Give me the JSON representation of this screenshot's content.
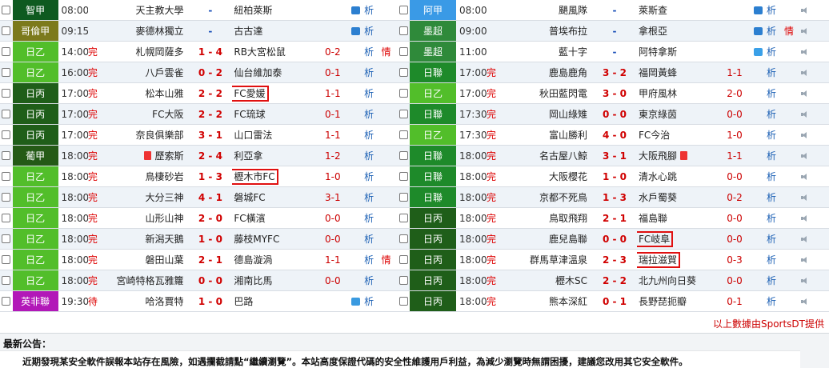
{
  "left_matches": [
    {
      "league": "智甲",
      "league_color": "#0e5a20",
      "time": "08:00",
      "status": "",
      "home": "天主教大學",
      "score": "-",
      "away": "紐柏萊斯",
      "handicap": "",
      "tv": "#2c7fd0",
      "analysis": "析",
      "intel": "",
      "highlight": ""
    },
    {
      "league": "哥倫甲",
      "league_color": "#7c7a1c",
      "time": "09:15",
      "status": "",
      "home": "麥德林獨立",
      "score": "-",
      "away": "古古達",
      "handicap": "",
      "tv": "#2c7fd0",
      "analysis": "析",
      "intel": "",
      "highlight": ""
    },
    {
      "league": "日乙",
      "league_color": "#52be2a",
      "time": "14:00",
      "status": "完",
      "home": "札幌岡薩多",
      "score": "1 - 4",
      "away": "RB大宮松鼠",
      "handicap": "0-2",
      "tv": "",
      "analysis": "析",
      "intel": "情",
      "highlight": ""
    },
    {
      "league": "日乙",
      "league_color": "#52be2a",
      "time": "16:00",
      "status": "完",
      "home": "八戶雲雀",
      "score": "0 - 2",
      "away": "仙台維加泰",
      "handicap": "0-1",
      "tv": "",
      "analysis": "析",
      "intel": "",
      "highlight": ""
    },
    {
      "league": "日丙",
      "league_color": "#1f5e19",
      "time": "17:00",
      "status": "完",
      "home": "松本山雅",
      "score": "2 - 2",
      "away": "FC愛媛",
      "handicap": "1-1",
      "tv": "",
      "analysis": "析",
      "intel": "",
      "highlight": "away"
    },
    {
      "league": "日丙",
      "league_color": "#1f5e19",
      "time": "17:00",
      "status": "完",
      "home": "FC大阪",
      "score": "2 - 2",
      "away": "FC琉球",
      "handicap": "0-1",
      "tv": "",
      "analysis": "析",
      "intel": "",
      "highlight": ""
    },
    {
      "league": "日丙",
      "league_color": "#1f5e19",
      "time": "17:00",
      "status": "完",
      "home": "奈良俱樂部",
      "score": "3 - 1",
      "away": "山口雷法",
      "handicap": "1-1",
      "tv": "",
      "analysis": "析",
      "intel": "",
      "highlight": ""
    },
    {
      "league": "葡甲",
      "league_color": "#245a16",
      "time": "18:00",
      "status": "完",
      "home": "歷索斯",
      "home_flag": true,
      "score": "2 - 4",
      "away": "利亞拿",
      "handicap": "1-2",
      "tv": "",
      "analysis": "析",
      "intel": "",
      "highlight": ""
    },
    {
      "league": "日乙",
      "league_color": "#52be2a",
      "time": "18:00",
      "status": "完",
      "home": "鳥棲砂岩",
      "score": "1 - 3",
      "away": "櫪木市FC",
      "handicap": "1-0",
      "tv": "",
      "analysis": "析",
      "intel": "",
      "highlight": "away"
    },
    {
      "league": "日乙",
      "league_color": "#52be2a",
      "time": "18:00",
      "status": "完",
      "home": "大分三神",
      "score": "4 - 1",
      "away": "磐城FC",
      "handicap": "3-1",
      "tv": "",
      "analysis": "析",
      "intel": "",
      "highlight": ""
    },
    {
      "league": "日乙",
      "league_color": "#52be2a",
      "time": "18:00",
      "status": "完",
      "home": "山形山神",
      "score": "2 - 0",
      "away": "FC橫濱",
      "handicap": "0-0",
      "tv": "",
      "analysis": "析",
      "intel": "",
      "highlight": ""
    },
    {
      "league": "日乙",
      "league_color": "#52be2a",
      "time": "18:00",
      "status": "完",
      "home": "新潟天鵝",
      "score": "1 - 0",
      "away": "藤枝MYFC",
      "handicap": "0-0",
      "tv": "",
      "analysis": "析",
      "intel": "",
      "highlight": ""
    },
    {
      "league": "日乙",
      "league_color": "#52be2a",
      "time": "18:00",
      "status": "完",
      "home": "磐田山葉",
      "score": "2 - 1",
      "away": "德島漩渦",
      "handicap": "1-1",
      "tv": "",
      "analysis": "析",
      "intel": "情",
      "highlight": ""
    },
    {
      "league": "日乙",
      "league_color": "#52be2a",
      "time": "18:00",
      "status": "完",
      "home": "宮崎特格瓦雅籮",
      "score": "0 - 0",
      "away": "湘南比馬",
      "handicap": "0-0",
      "tv": "",
      "analysis": "析",
      "intel": "",
      "highlight": ""
    },
    {
      "league": "英非聯",
      "league_color": "#b218b8",
      "time": "19:30",
      "status": "待",
      "home": "哈洛賈特",
      "score": "1 - 0",
      "away": "巴路",
      "handicap": "",
      "tv": "#3a9ae0",
      "analysis": "析",
      "intel": "",
      "highlight": ""
    }
  ],
  "right_matches": [
    {
      "league": "阿甲",
      "league_color": "#3a9ae6",
      "time": "08:00",
      "status": "",
      "home": "颶風隊",
      "score": "-",
      "away": "萊斯查",
      "handicap": "",
      "tv": "#2c7fd0",
      "analysis": "析",
      "intel": "",
      "highlight": ""
    },
    {
      "league": "墨超",
      "league_color": "#2f8a3a",
      "time": "09:00",
      "status": "",
      "home": "普埃布拉",
      "score": "-",
      "away": "拿根亞",
      "handicap": "",
      "tv": "#2c7fd0",
      "analysis": "析",
      "intel": "情",
      "highlight": ""
    },
    {
      "league": "墨超",
      "league_color": "#2f8a3a",
      "time": "11:00",
      "status": "",
      "home": "藍十字",
      "score": "-",
      "away": "阿特拿斯",
      "handicap": "",
      "tv": "#3aa0e8",
      "analysis": "析",
      "intel": "",
      "highlight": ""
    },
    {
      "league": "日聯",
      "league_color": "#1e8a2a",
      "time": "17:00",
      "status": "完",
      "home": "鹿島鹿角",
      "score": "3 - 2",
      "away": "福岡黃蜂",
      "handicap": "1-1",
      "tv": "",
      "analysis": "析",
      "intel": "",
      "highlight": ""
    },
    {
      "league": "日乙",
      "league_color": "#52be2a",
      "time": "17:00",
      "status": "完",
      "home": "秋田藍閃電",
      "score": "3 - 0",
      "away": "甲府風林",
      "handicap": "2-0",
      "tv": "",
      "analysis": "析",
      "intel": "",
      "highlight": ""
    },
    {
      "league": "日聯",
      "league_color": "#1e8a2a",
      "time": "17:30",
      "status": "完",
      "home": "岡山綠雉",
      "score": "0 - 0",
      "away": "東京綠茵",
      "handicap": "0-0",
      "tv": "",
      "analysis": "析",
      "intel": "",
      "highlight": ""
    },
    {
      "league": "日乙",
      "league_color": "#52be2a",
      "time": "17:30",
      "status": "完",
      "home": "富山勝利",
      "score": "4 - 0",
      "away": "FC今治",
      "handicap": "1-0",
      "tv": "",
      "analysis": "析",
      "intel": "",
      "highlight": ""
    },
    {
      "league": "日聯",
      "league_color": "#1e8a2a",
      "time": "18:00",
      "status": "完",
      "home": "名古屋八鯨",
      "score": "3 - 1",
      "away": "大阪飛腳",
      "away_flag": true,
      "handicap": "1-1",
      "tv": "",
      "analysis": "析",
      "intel": "",
      "highlight": ""
    },
    {
      "league": "日聯",
      "league_color": "#1e8a2a",
      "time": "18:00",
      "status": "完",
      "home": "大阪櫻花",
      "score": "1 - 0",
      "away": "清水心跳",
      "handicap": "0-0",
      "tv": "",
      "analysis": "析",
      "intel": "",
      "highlight": ""
    },
    {
      "league": "日聯",
      "league_color": "#1e8a2a",
      "time": "18:00",
      "status": "完",
      "home": "京都不死鳥",
      "score": "1 - 3",
      "away": "水戶蜀葵",
      "handicap": "0-2",
      "tv": "",
      "analysis": "析",
      "intel": "",
      "highlight": ""
    },
    {
      "league": "日丙",
      "league_color": "#1f5e19",
      "time": "18:00",
      "status": "完",
      "home": "鳥取飛翔",
      "score": "2 - 1",
      "away": "福島聯",
      "handicap": "0-0",
      "tv": "",
      "analysis": "析",
      "intel": "",
      "highlight": ""
    },
    {
      "league": "日丙",
      "league_color": "#1f5e19",
      "time": "18:00",
      "status": "完",
      "home": "鹿兒島聯",
      "score": "0 - 0",
      "away": "FC岐阜",
      "handicap": "0-0",
      "tv": "",
      "analysis": "析",
      "intel": "",
      "highlight": "away"
    },
    {
      "league": "日丙",
      "league_color": "#1f5e19",
      "time": "18:00",
      "status": "完",
      "home": "群馬草津溫泉",
      "score": "2 - 3",
      "away": "瑞拉滋賀",
      "handicap": "0-3",
      "tv": "",
      "analysis": "析",
      "intel": "",
      "highlight": "away"
    },
    {
      "league": "日丙",
      "league_color": "#1f5e19",
      "time": "18:00",
      "status": "完",
      "home": "櫪木SC",
      "score": "2 - 2",
      "away": "北九州向日葵",
      "handicap": "0-0",
      "tv": "",
      "analysis": "析",
      "intel": "",
      "highlight": ""
    },
    {
      "league": "日丙",
      "league_color": "#1f5e19",
      "time": "18:00",
      "status": "完",
      "home": "熊本深紅",
      "score": "0 - 1",
      "away": "長野琵扼瓣",
      "handicap": "0-1",
      "tv": "",
      "analysis": "析",
      "intel": "",
      "highlight": ""
    }
  ],
  "credit": "以上數據由SportsDT提供",
  "notice": {
    "title": "最新公告：",
    "text": "近期發現某安全軟件誤報本站存在風險，如遇攔截請點“繼續瀏覽”。本站高度保證代碼的安全性維護用戶利益，為減少瀏覽時無謂困擾，建議您改用其它安全軟件。"
  },
  "colors": {
    "score_home_win": "#d00000",
    "score_other": "#1a4fb8",
    "handicap": "#cc0000",
    "link": "#1a5fb4"
  }
}
